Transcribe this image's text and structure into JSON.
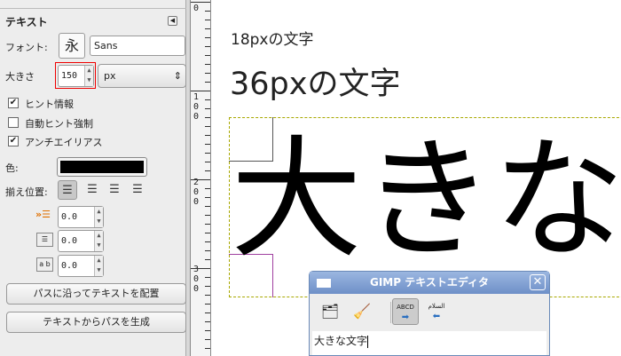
{
  "panel": {
    "title": "テキスト",
    "font_label": "フォント:",
    "font_preview": "永",
    "font_name": "Sans",
    "size_label": "大きさ",
    "size_value": "150",
    "size_unit": "px",
    "hinting": "ヒント情報",
    "autohint": "自動ヒント強制",
    "antialias": "アンチエイリアス",
    "color_label": "色:",
    "justify_label": "揃え位置:",
    "indent": "0.0",
    "line_spacing": "0.0",
    "letter_spacing": "0.0",
    "path_along_button": "パスに沿ってテキストを配置",
    "path_from_button": "テキストからパスを生成",
    "checks": {
      "hinting": true,
      "autohint": false,
      "antialias": true
    },
    "text_color": "#000000"
  },
  "ruler": {
    "labels": [
      "0",
      "100",
      "200",
      "300"
    ]
  },
  "canvas": {
    "text18": "18pxの文字",
    "text36": "36pxの文字",
    "text_big": "大きな"
  },
  "dialog": {
    "title": "GIMP テキストエディタ",
    "ltr_label": "ABCD",
    "rtl_label": "السلام",
    "content": "大きな文字"
  }
}
